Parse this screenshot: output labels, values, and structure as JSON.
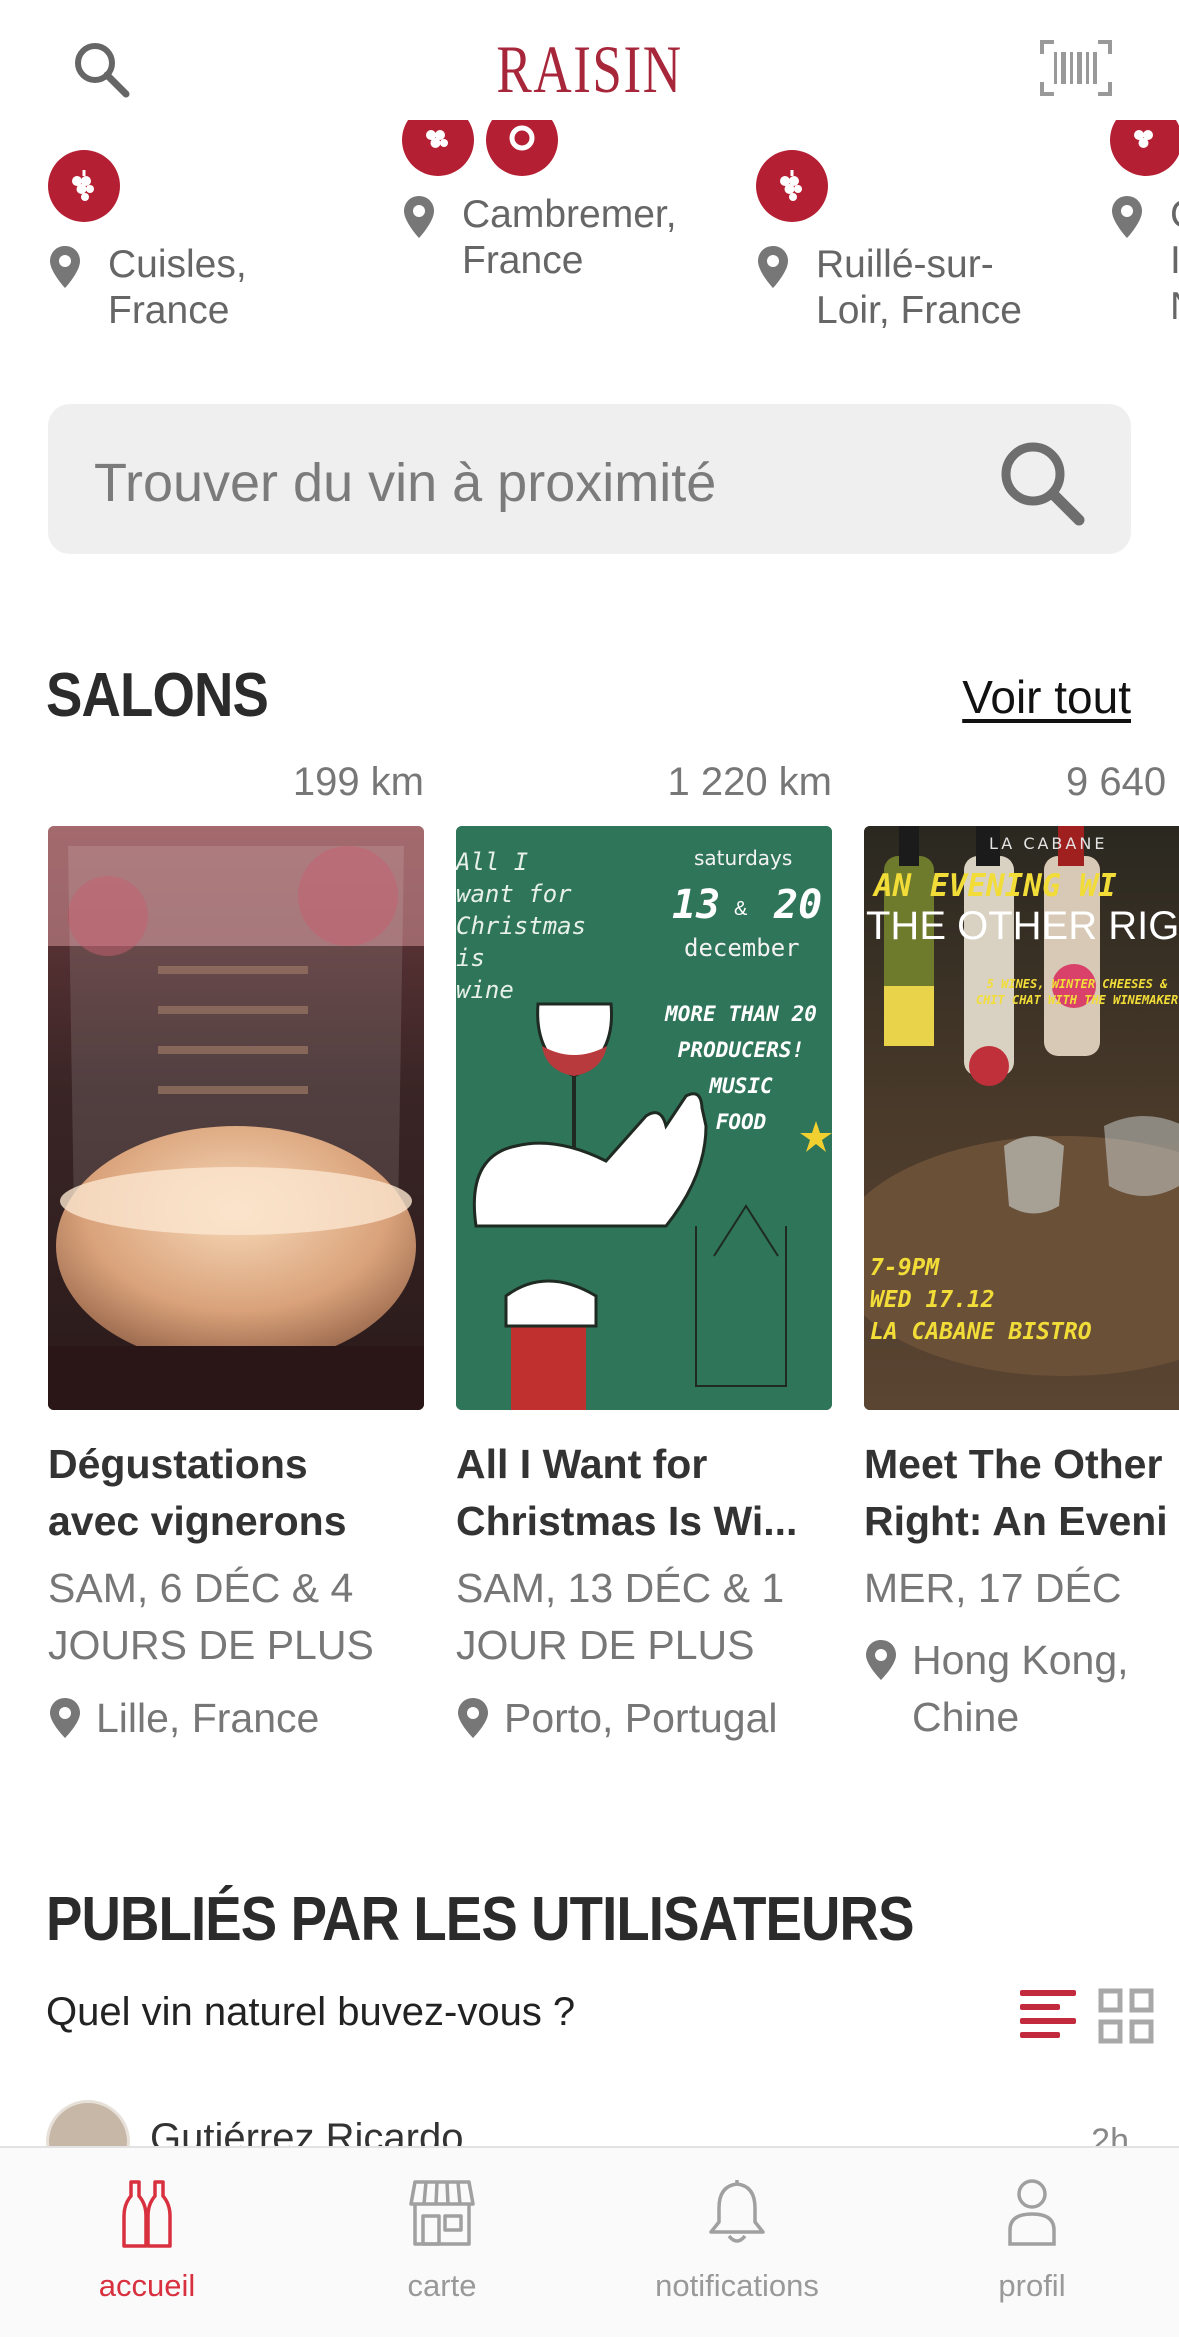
{
  "header": {
    "logo": "RAISIN"
  },
  "producers": [
    {
      "location": "Cuisles,\nFrance"
    },
    {
      "location": "Cambremer,\nFrance"
    },
    {
      "location": "Ruillé-sur-\nLoir, France"
    },
    {
      "location": "C\nI\nN"
    }
  ],
  "search": {
    "placeholder": "Trouver du vin à proximité"
  },
  "salons": {
    "title": "SALONS",
    "see_all": "Voir tout",
    "events": [
      {
        "distance": "199 km",
        "title": "Dégustations\navec vignerons",
        "date": "SAM, 6 DÉC & 4\nJOURS DE PLUS",
        "location": "Lille, France"
      },
      {
        "distance": "1 220 km",
        "title": "All I Want for\nChristmas Is Wi...",
        "date": "SAM, 13 DÉC & 1\nJOUR DE PLUS",
        "location": "Porto, Portugal",
        "poster": {
          "text1": "All I\nwant for\nChristmas\nis\nwine",
          "text2": "saturdays",
          "text3": "13",
          "text4": "&",
          "text5": "20",
          "text6": "december",
          "text7": "MORE THAN 20\nPRODUCERS!\nMUSIC\nFOOD"
        }
      },
      {
        "distance": "9 640",
        "title": "Meet The Other\nRight: An Eveni",
        "date": "MER, 17 DÉC",
        "location": "Hong Kong,\nChine",
        "poster": {
          "text1": "LA CABANE",
          "text2": "AN EVENING WI",
          "text3": "THE OTHER RIG",
          "text4": "5 WINES, WINTER CHEESES &\nCHIT CHAT WITH THE WINEMAKER",
          "text5": "7-9PM\nWED 17.12\nLA CABANE BISTRO"
        }
      }
    ]
  },
  "users": {
    "title": "PUBLIÉS PAR LES UTILISATEURS",
    "question": "Quel vin naturel buvez-vous ?",
    "post": {
      "author": "Gutiérrez Ricardo",
      "time": "2h"
    }
  },
  "tabbar": {
    "tabs": [
      {
        "label": "accueil"
      },
      {
        "label": "carte"
      },
      {
        "label": "notifications"
      },
      {
        "label": "profil"
      }
    ]
  },
  "colors": {
    "brand": "#a8263a",
    "accent": "#d9303f",
    "badge": "#b51f33"
  }
}
